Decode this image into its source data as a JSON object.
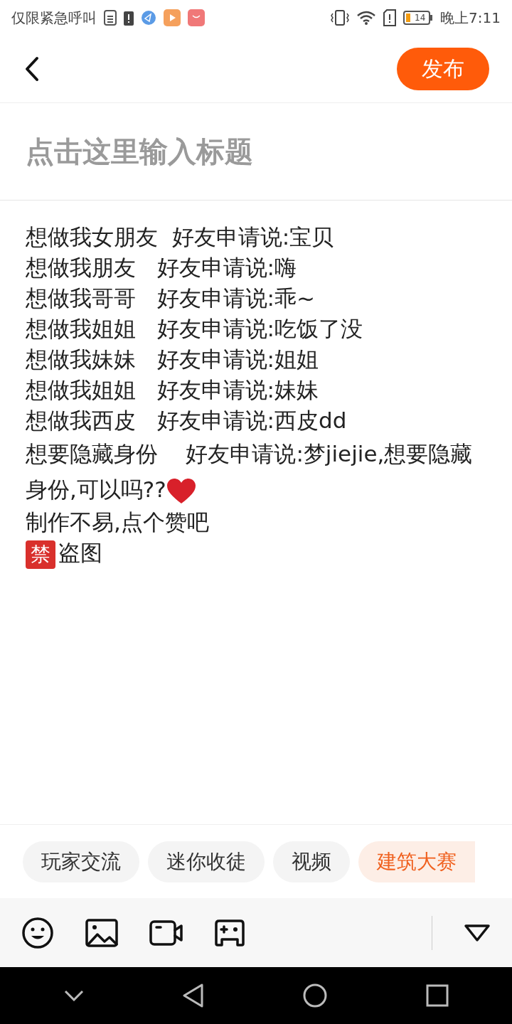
{
  "status_bar": {
    "carrier": "仅限紧急呼叫",
    "battery": "14",
    "time": "晚上7:11"
  },
  "header": {
    "publish": "发布"
  },
  "title_field": {
    "placeholder": "点击这里输入标题"
  },
  "body": [
    {
      "text": "想做我女朋友  好友申请说:宝贝"
    },
    {
      "text": "想做我朋友   好友申请说:嗨"
    },
    {
      "text": "想做我哥哥   好友申请说:乖~"
    },
    {
      "text": "想做我姐姐   好友申请说:吃饭了没"
    },
    {
      "text": "想做我妹妹   好友申请说:姐姐"
    },
    {
      "text": "想做我姐姐   好友申请说:妹妹"
    },
    {
      "text": "想做我西皮   好友申请说:西皮dd"
    },
    {
      "text": "想要隐藏身份    好友申请说:梦jiejie,想要隐藏身份,可以吗??",
      "heart": true
    },
    {
      "text": "制作不易,点个赞吧"
    },
    {
      "text": "盗图",
      "badge": "禁"
    }
  ],
  "tags": [
    {
      "label": "玩家交流",
      "selected": false
    },
    {
      "label": "迷你收徒",
      "selected": false
    },
    {
      "label": "视频",
      "selected": false
    },
    {
      "label": "建筑大赛",
      "selected": true
    }
  ]
}
